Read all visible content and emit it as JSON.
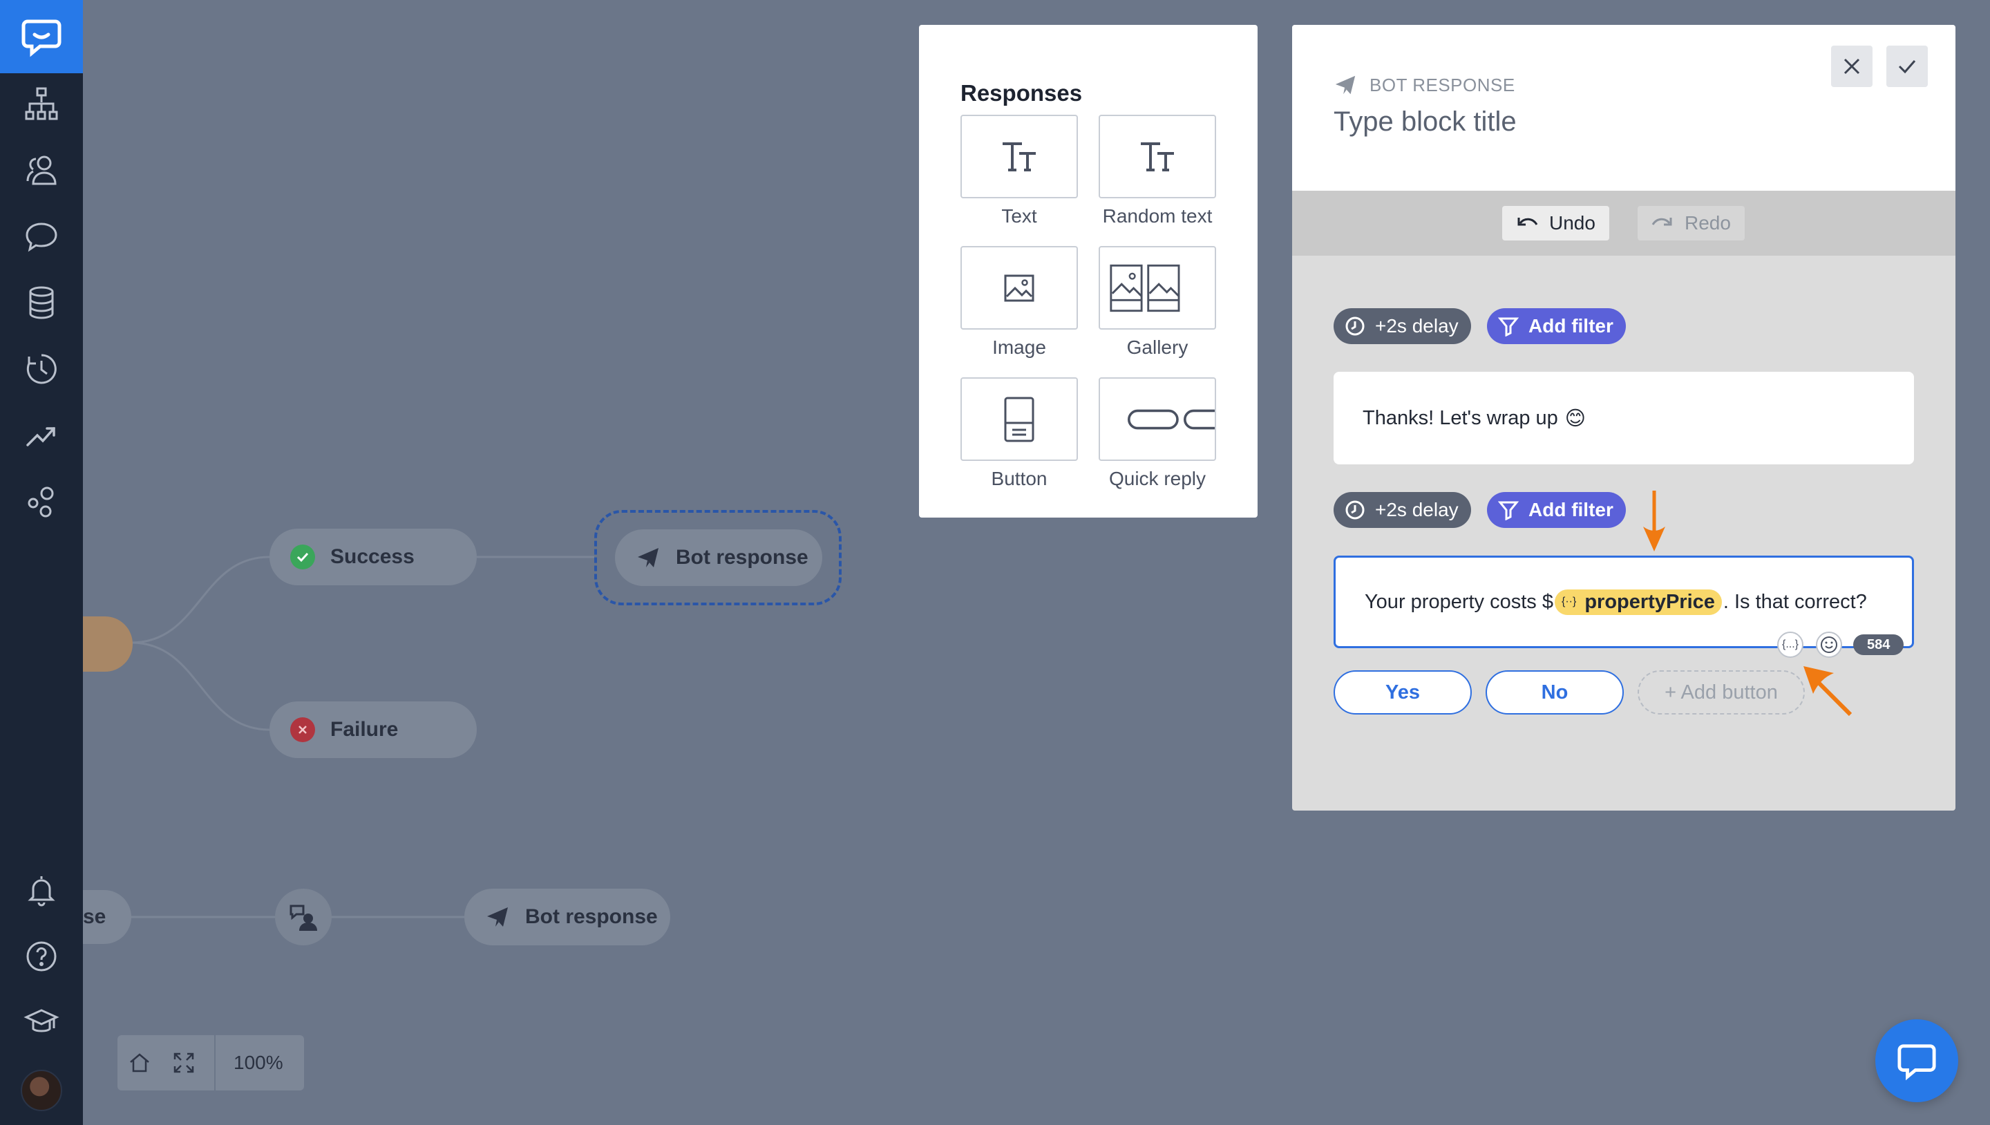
{
  "sidebar": {
    "logo": "chat-logo-icon",
    "items": [
      {
        "icon": "structure-icon"
      },
      {
        "icon": "users-icon"
      },
      {
        "icon": "chat-bubble-icon"
      },
      {
        "icon": "database-icon"
      },
      {
        "icon": "history-icon"
      },
      {
        "icon": "trending-icon"
      },
      {
        "icon": "integrations-icon"
      }
    ],
    "bottom": [
      {
        "icon": "bell-icon"
      },
      {
        "icon": "help-icon"
      },
      {
        "icon": "graduation-cap-icon"
      }
    ]
  },
  "canvas": {
    "nodes": {
      "success": "Success",
      "failure": "Failure",
      "bot_response_top": "Bot response",
      "bot_response_bottom": "Bot response",
      "left_partial": "se"
    },
    "zoom": "100%"
  },
  "responses": {
    "title": "Responses",
    "items": [
      {
        "label": "Text",
        "icon": "text-icon"
      },
      {
        "label": "Random text",
        "icon": "random-text-icon"
      },
      {
        "label": "Image",
        "icon": "image-icon"
      },
      {
        "label": "Gallery",
        "icon": "gallery-icon"
      },
      {
        "label": "Button",
        "icon": "button-icon"
      },
      {
        "label": "Quick reply",
        "icon": "quick-reply-icon"
      }
    ]
  },
  "bot_panel": {
    "kicker": "BOT RESPONSE",
    "title": "Type block title",
    "undo": "Undo",
    "redo": "Redo",
    "block1": {
      "delay": "+2s delay",
      "filter": "Add filter",
      "message_text": "Thanks! Let's wrap up",
      "emoji": "😊"
    },
    "block2": {
      "delay": "+2s delay",
      "filter": "Add filter",
      "message_before": "Your property costs $",
      "variable": "propertyPrice",
      "message_after": ". Is that correct?",
      "var_tool": "{...}",
      "char_count": "584",
      "buttons": [
        "Yes",
        "No"
      ],
      "add_button": "+ Add button"
    }
  },
  "colors": {
    "accent": "#2779e8",
    "sidebar": "#1b2536",
    "canvas": "#6b7689",
    "filter": "#5b61d9",
    "variable": "#f9d86b",
    "annotation": "#f07a12"
  }
}
